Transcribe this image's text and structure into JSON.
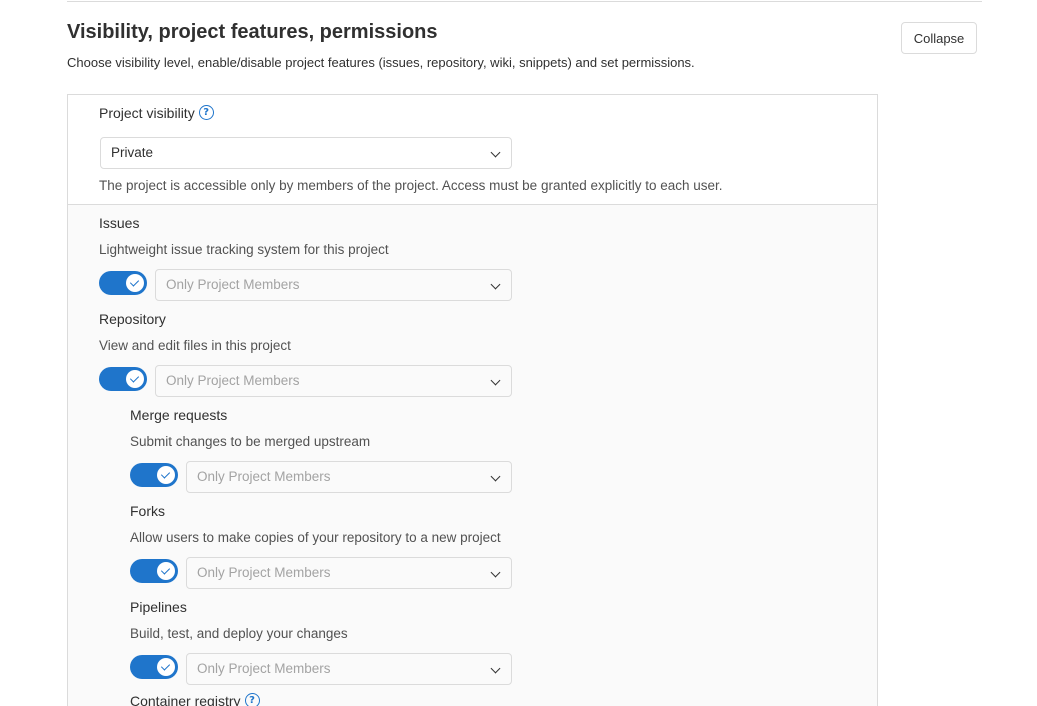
{
  "section": {
    "title": "Visibility, project features, permissions",
    "description": "Choose visibility level, enable/disable project features (issues, repository, wiki, snippets) and set permissions.",
    "collapse_label": "Collapse"
  },
  "visibility": {
    "label": "Project visibility",
    "help_icon": "question-circle-icon",
    "selected": "Private",
    "description": "The project is accessible only by members of the project. Access must be granted explicitly to each user."
  },
  "features": [
    {
      "name": "Issues",
      "description": "Lightweight issue tracking system for this project",
      "enabled": true,
      "access": "Only Project Members"
    },
    {
      "name": "Repository",
      "description": "View and edit files in this project",
      "enabled": true,
      "access": "Only Project Members"
    },
    {
      "name": "Merge requests",
      "description": "Submit changes to be merged upstream",
      "enabled": true,
      "access": "Only Project Members"
    },
    {
      "name": "Forks",
      "description": "Allow users to make copies of your repository to a new project",
      "enabled": true,
      "access": "Only Project Members"
    },
    {
      "name": "Pipelines",
      "description": "Build, test, and deploy your changes",
      "enabled": true,
      "access": "Only Project Members"
    },
    {
      "name": "Container registry",
      "help_icon": "question-circle-icon"
    }
  ],
  "colors": {
    "accent": "#1f75cb",
    "border": "#dbdbdb",
    "panel_bg": "#fafafa"
  }
}
